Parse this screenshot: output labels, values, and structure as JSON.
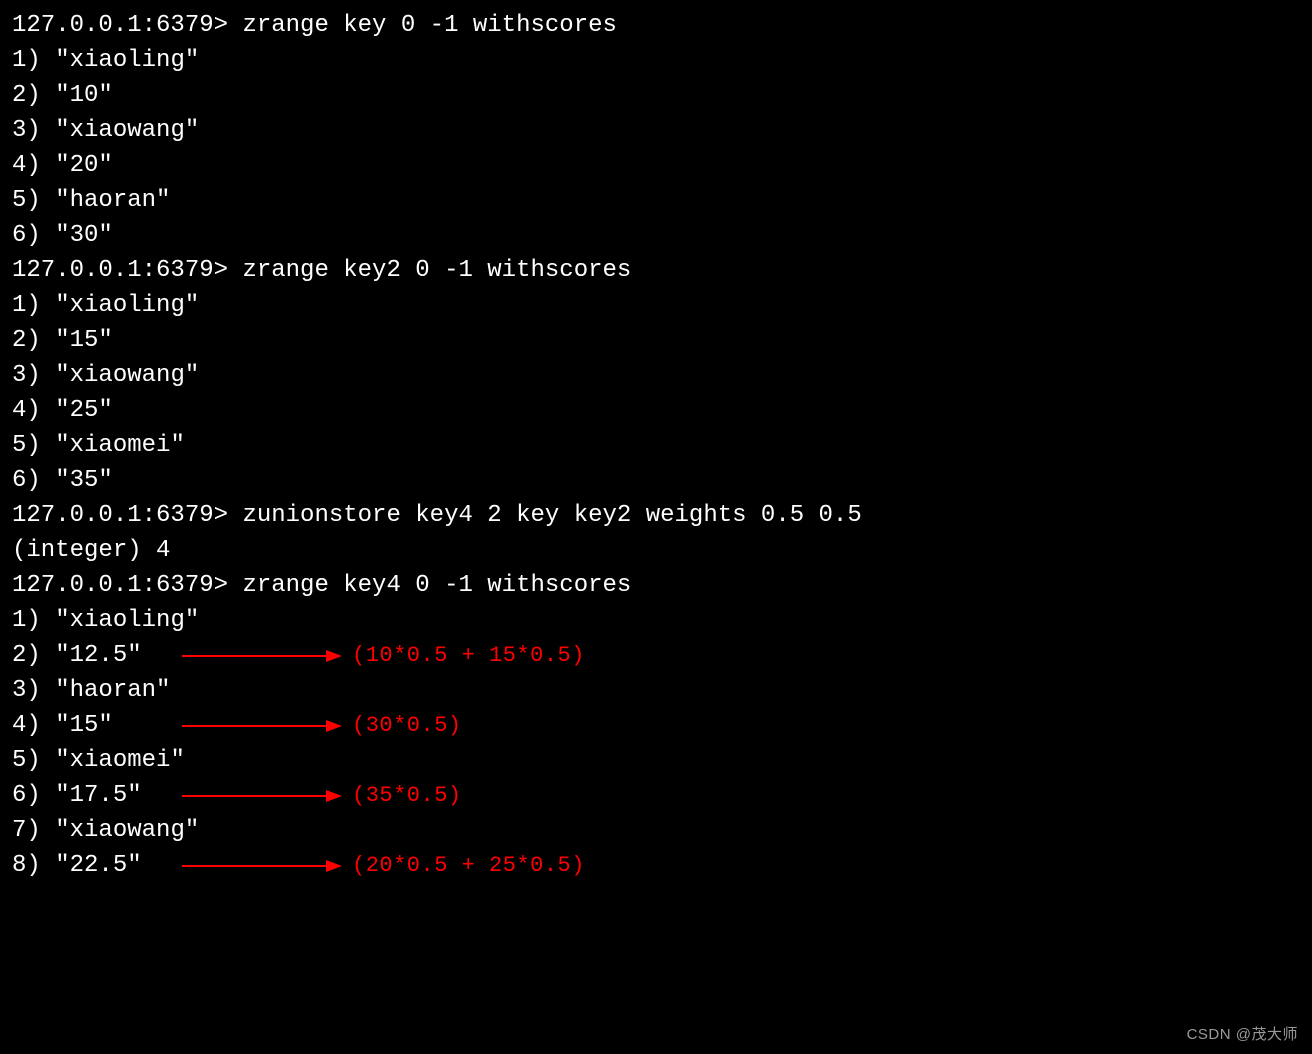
{
  "prompt": "127.0.0.1:6379> ",
  "block1": {
    "command": "zrange key 0 -1 withscores",
    "rows": [
      {
        "n": "1)",
        "v": "\"xiaoling\""
      },
      {
        "n": "2)",
        "v": "\"10\""
      },
      {
        "n": "3)",
        "v": "\"xiaowang\""
      },
      {
        "n": "4)",
        "v": "\"20\""
      },
      {
        "n": "5)",
        "v": "\"haoran\""
      },
      {
        "n": "6)",
        "v": "\"30\""
      }
    ]
  },
  "block2": {
    "command": "zrange key2 0 -1 withscores",
    "rows": [
      {
        "n": "1)",
        "v": "\"xiaoling\""
      },
      {
        "n": "2)",
        "v": "\"15\""
      },
      {
        "n": "3)",
        "v": "\"xiaowang\""
      },
      {
        "n": "4)",
        "v": "\"25\""
      },
      {
        "n": "5)",
        "v": "\"xiaomei\""
      },
      {
        "n": "6)",
        "v": "\"35\""
      }
    ]
  },
  "block3": {
    "command": "zunionstore key4 2 key key2 weights 0.5 0.5",
    "result": "(integer) 4"
  },
  "block4": {
    "command": "zrange key4 0 -1 withscores",
    "rows": [
      {
        "n": "1)",
        "v": "\"xiaoling\"",
        "annot": ""
      },
      {
        "n": "2)",
        "v": "\"12.5\"",
        "annot": "(10*0.5 + 15*0.5)"
      },
      {
        "n": "3)",
        "v": "\"haoran\"",
        "annot": ""
      },
      {
        "n": "4)",
        "v": "\"15\"",
        "annot": "(30*0.5)"
      },
      {
        "n": "5)",
        "v": "\"xiaomei\"",
        "annot": ""
      },
      {
        "n": "6)",
        "v": "\"17.5\"",
        "annot": "(35*0.5)"
      },
      {
        "n": "7)",
        "v": "\"xiaowang\"",
        "annot": ""
      },
      {
        "n": "8)",
        "v": "\"22.5\"",
        "annot": "(20*0.5 + 25*0.5)"
      }
    ]
  },
  "watermark": "CSDN @茂大师"
}
